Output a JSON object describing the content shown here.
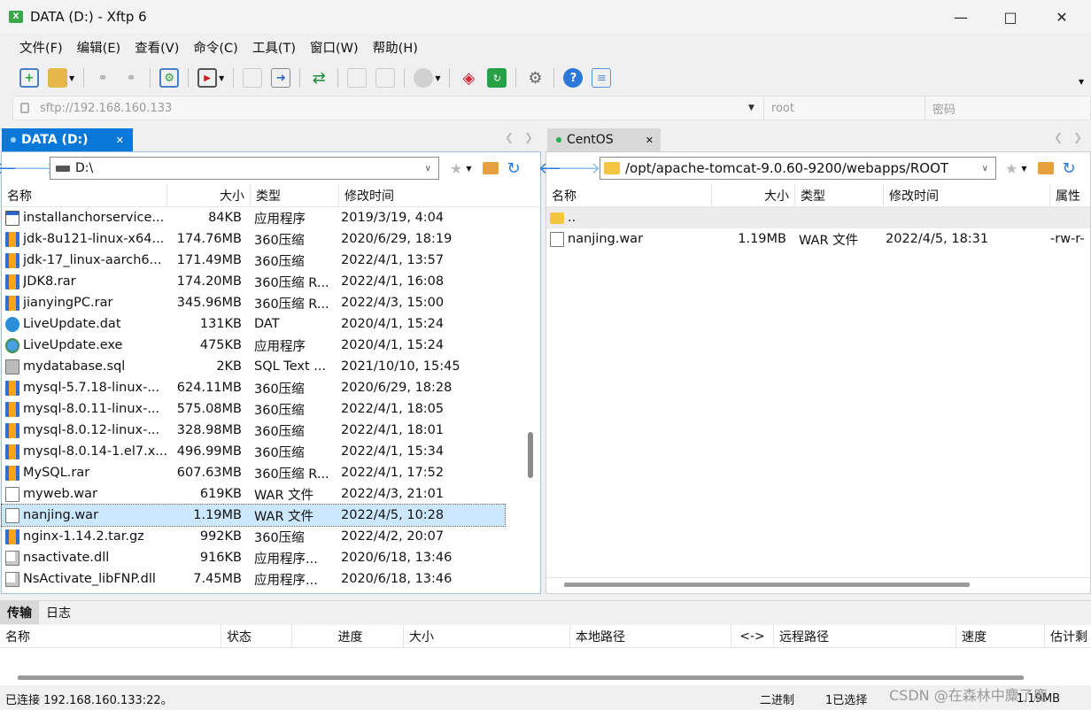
{
  "window": {
    "title": "DATA (D:) - Xftp 6",
    "icon_label": "X"
  },
  "menu": [
    "文件(F)",
    "编辑(E)",
    "查看(V)",
    "命令(C)",
    "工具(T)",
    "窗口(W)",
    "帮助(H)"
  ],
  "address": {
    "url_placeholder": "sftp://192.168.160.133",
    "user_placeholder": "root",
    "password_placeholder": "密码"
  },
  "left": {
    "tab_label": "DATA (D:)",
    "path": "D:\\",
    "columns": [
      "名称",
      "大小",
      "类型",
      "修改时间"
    ],
    "files": [
      {
        "name": "installanchorservice...",
        "size": "84KB",
        "type": "应用程序",
        "modified": "2019/3/19, 4:04",
        "icon": "exe-icon"
      },
      {
        "name": "jdk-8u121-linux-x64...",
        "size": "174.76MB",
        "type": "360压缩",
        "modified": "2020/6/29, 18:19",
        "icon": "archive-icon"
      },
      {
        "name": "jdk-17_linux-aarch6...",
        "size": "171.49MB",
        "type": "360压缩",
        "modified": "2022/4/1, 13:57",
        "icon": "archive-icon"
      },
      {
        "name": "JDK8.rar",
        "size": "174.20MB",
        "type": "360压缩 R...",
        "modified": "2022/4/1, 16:08",
        "icon": "archive-icon"
      },
      {
        "name": "jianyingPC.rar",
        "size": "345.96MB",
        "type": "360压缩 R...",
        "modified": "2022/4/3, 15:00",
        "icon": "archive-icon"
      },
      {
        "name": "LiveUpdate.dat",
        "size": "131KB",
        "type": "DAT",
        "modified": "2020/4/1, 15:24",
        "icon": "dat-icon"
      },
      {
        "name": "LiveUpdate.exe",
        "size": "475KB",
        "type": "应用程序",
        "modified": "2020/4/1, 15:24",
        "icon": "globe-icon"
      },
      {
        "name": "mydatabase.sql",
        "size": "2KB",
        "type": "SQL Text ...",
        "modified": "2021/10/10, 15:45",
        "icon": "sql-icon"
      },
      {
        "name": "mysql-5.7.18-linux-...",
        "size": "624.11MB",
        "type": "360压缩",
        "modified": "2020/6/29, 18:28",
        "icon": "archive-icon"
      },
      {
        "name": "mysql-8.0.11-linux-...",
        "size": "575.08MB",
        "type": "360压缩",
        "modified": "2022/4/1, 18:05",
        "icon": "archive-icon"
      },
      {
        "name": "mysql-8.0.12-linux-...",
        "size": "328.98MB",
        "type": "360压缩",
        "modified": "2022/4/1, 18:01",
        "icon": "archive-icon"
      },
      {
        "name": "mysql-8.0.14-1.el7.x...",
        "size": "496.99MB",
        "type": "360压缩",
        "modified": "2022/4/1, 15:34",
        "icon": "archive-icon"
      },
      {
        "name": "MySQL.rar",
        "size": "607.63MB",
        "type": "360压缩 R...",
        "modified": "2022/4/1, 17:52",
        "icon": "archive-icon"
      },
      {
        "name": "myweb.war",
        "size": "619KB",
        "type": "WAR 文件",
        "modified": "2022/4/3, 21:01",
        "icon": "document-icon"
      },
      {
        "name": "nanjing.war",
        "size": "1.19MB",
        "type": "WAR 文件",
        "modified": "2022/4/5, 10:28",
        "icon": "document-icon",
        "selected": true
      },
      {
        "name": "nginx-1.14.2.tar.gz",
        "size": "992KB",
        "type": "360压缩",
        "modified": "2022/4/2, 20:07",
        "icon": "archive-icon"
      },
      {
        "name": "nsactivate.dll",
        "size": "916KB",
        "type": "应用程序...",
        "modified": "2020/6/18, 13:46",
        "icon": "dll-icon"
      },
      {
        "name": "NsActivate_libFNP.dll",
        "size": "7.45MB",
        "type": "应用程序...",
        "modified": "2020/6/18, 13:46",
        "icon": "dll-icon"
      }
    ]
  },
  "right": {
    "tab_label": "CentOS",
    "path": "/opt/apache-tomcat-9.0.60-9200/webapps/ROOT",
    "columns": [
      "名称",
      "大小",
      "类型",
      "修改时间",
      "属性"
    ],
    "files": [
      {
        "name": "..",
        "size": "",
        "type": "",
        "modified": "",
        "attr": "",
        "icon": "folder-icon"
      },
      {
        "name": "nanjing.war",
        "size": "1.19MB",
        "type": "WAR 文件",
        "modified": "2022/4/5, 18:31",
        "attr": "-rw-r-",
        "icon": "document-icon"
      }
    ]
  },
  "bottom": {
    "tabs": [
      "传输",
      "日志"
    ],
    "columns": [
      "名称",
      "状态",
      "进度",
      "大小",
      "本地路径",
      "<->",
      "远程路径",
      "速度",
      "估计剩"
    ]
  },
  "status": {
    "connection": "已连接 192.168.160.133:22。",
    "mode": "二进制",
    "selection": "1已选择",
    "size": "1.19MB",
    "watermark": "CSDN @在森林中麋了鹿"
  },
  "colors": {
    "accent": "#0078d7",
    "tab_active": "#0a78d8",
    "selected_row": "#cce8ff",
    "connected_dot": "#22b14c"
  }
}
